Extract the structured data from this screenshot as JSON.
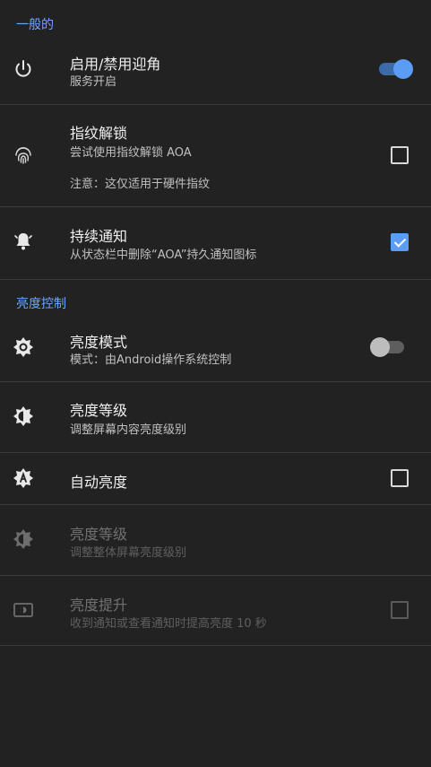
{
  "sections": {
    "general": "一般的",
    "brightness": "亮度控制"
  },
  "rows": {
    "toggle_aoa": {
      "title": "启用/禁用迎角",
      "subtitle": "服务开启",
      "switch_on": true
    },
    "fingerprint": {
      "title": "指纹解锁",
      "subtitle": "尝试使用指纹解锁 AOA",
      "note": "注意：这仅适用于硬件指纹",
      "checked": false
    },
    "persistent": {
      "title": "持续通知",
      "subtitle": "从状态栏中删除“AOA”持久通知图标",
      "checked": true
    },
    "brightness_mode": {
      "title": "亮度模式",
      "subtitle": "模式：由Android操作系统控制",
      "switch_on": false
    },
    "brightness_level": {
      "title": "亮度等级",
      "subtitle": "调整屏幕内容亮度级别"
    },
    "auto_brightness": {
      "title": "自动亮度",
      "checked": false
    },
    "brightness_level_overall": {
      "title": "亮度等级",
      "subtitle": "调整整体屏幕亮度级别",
      "enabled": false
    },
    "brightness_boost": {
      "title": "亮度提升",
      "subtitle": "收到通知或查看通知时提高亮度 10 秒",
      "checked": false,
      "enabled": false
    }
  },
  "colors": {
    "accent": "#5b9cf4",
    "background": "#222222",
    "divider": "#3a3a3a",
    "section_header": "#6ea6ff"
  },
  "icons": {
    "toggle_aoa": "power-icon",
    "fingerprint": "fingerprint-icon",
    "persistent": "bell-icon",
    "brightness_mode": "brightness-gear-icon",
    "brightness_level": "brightness-half-icon",
    "auto_brightness": "brightness-auto-icon",
    "brightness_level_overall": "brightness-half-icon",
    "brightness_boost": "screen-brightness-icon"
  }
}
